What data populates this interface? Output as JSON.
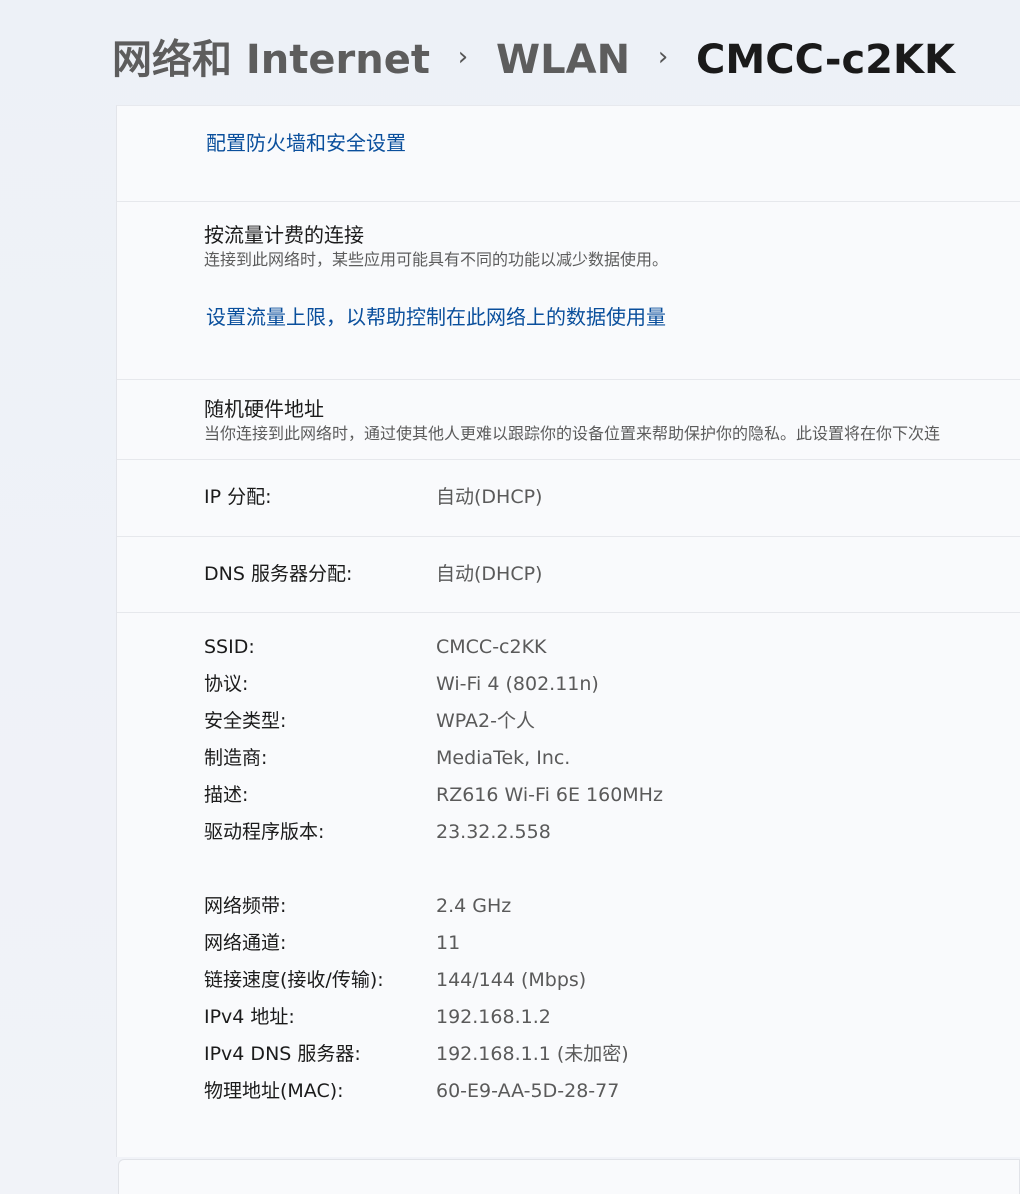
{
  "breadcrumb": {
    "items": [
      "网络和 Internet",
      "WLAN"
    ],
    "separator": "›",
    "current": "CMCC-c2KK"
  },
  "firewall": {
    "link": "配置防火墙和安全设置"
  },
  "metered": {
    "title": "按流量计费的连接",
    "description": "连接到此网络时，某些应用可能具有不同的功能以减少数据使用。",
    "link": "设置流量上限，以帮助控制在此网络上的数据使用量"
  },
  "random_hw": {
    "title": "随机硬件地址",
    "description": "当你连接到此网络时，通过使其他人更难以跟踪你的设备位置来帮助保护你的隐私。此设置将在你下次连"
  },
  "ip_assignment": {
    "label": "IP 分配:",
    "value": "自动(DHCP)"
  },
  "dns_assignment": {
    "label": "DNS 服务器分配:",
    "value": "自动(DHCP)"
  },
  "properties": {
    "group1": [
      {
        "label": "SSID:",
        "value": "CMCC-c2KK"
      },
      {
        "label": "协议:",
        "value": "Wi-Fi 4 (802.11n)"
      },
      {
        "label": "安全类型:",
        "value": "WPA2-个人"
      },
      {
        "label": "制造商:",
        "value": "MediaTek, Inc."
      },
      {
        "label": "描述:",
        "value": "RZ616 Wi-Fi 6E 160MHz"
      },
      {
        "label": "驱动程序版本:",
        "value": "23.32.2.558"
      }
    ],
    "group2": [
      {
        "label": "网络频带:",
        "value": "2.4 GHz"
      },
      {
        "label": "网络通道:",
        "value": "11"
      },
      {
        "label": "链接速度(接收/传输):",
        "value": "144/144 (Mbps)"
      },
      {
        "label": "IPv4 地址:",
        "value": "192.168.1.2"
      },
      {
        "label": "IPv4 DNS 服务器:",
        "value": "192.168.1.1 (未加密)"
      },
      {
        "label": "物理地址(MAC):",
        "value": "60-E9-AA-5D-28-77"
      }
    ]
  }
}
